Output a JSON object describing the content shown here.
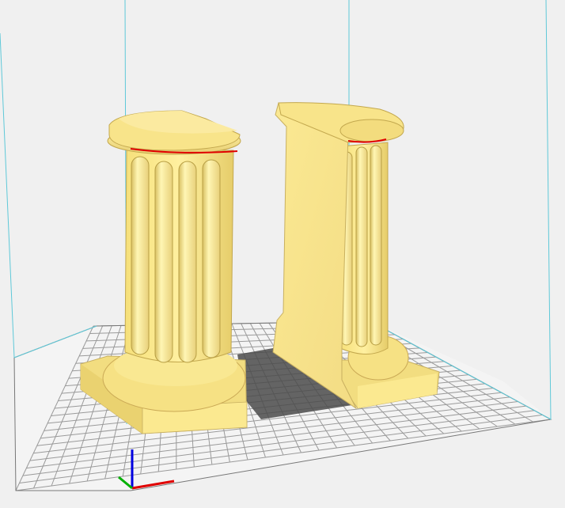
{
  "viewport": {
    "background": "#f0f0f0",
    "model_color": "#f8e690",
    "model_highlight": "#fff4b0",
    "model_shade": "#d9c26a",
    "model_dark": "#b89f45",
    "overhang_color": "#e00000",
    "build_volume_color": "#5ec8d8",
    "plate_color": "#f4f4f4",
    "grid_color": "#9a9a9a",
    "shadow_color": "#4a4a4a"
  },
  "axes": {
    "x_color": "#e00000",
    "y_color": "#00b000",
    "z_color": "#0000e0"
  },
  "objects": [
    {
      "name": "full-column",
      "icon": "column-icon"
    },
    {
      "name": "half-column",
      "icon": "column-half-icon"
    }
  ]
}
